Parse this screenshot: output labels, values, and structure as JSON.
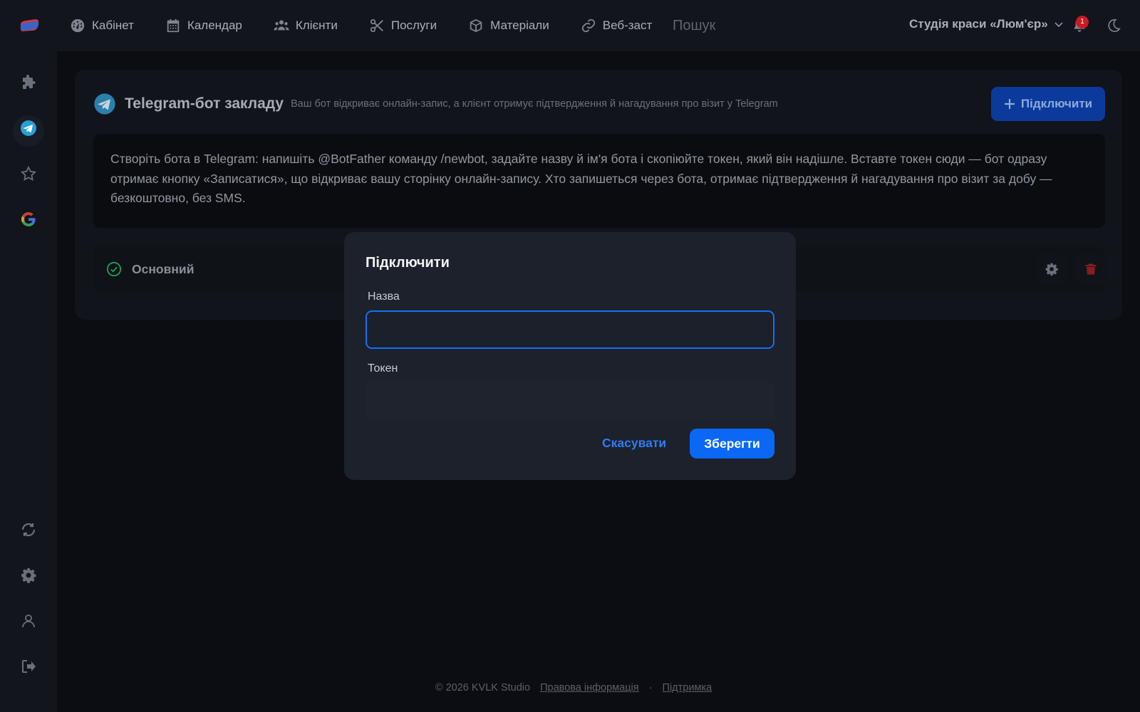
{
  "nav": {
    "items": [
      {
        "label": "Кабінет",
        "icon": "dashboard-icon"
      },
      {
        "label": "Календар",
        "icon": "calendar-icon"
      },
      {
        "label": "Клієнти",
        "icon": "users-icon"
      },
      {
        "label": "Послуги",
        "icon": "scissors-icon"
      },
      {
        "label": "Матеріали",
        "icon": "box-icon"
      },
      {
        "label": "Веб-заст",
        "icon": "link-icon"
      }
    ],
    "search_placeholder": "Пошук",
    "studio_name": "Студія краси «Люм'єр»",
    "notification_count": "1"
  },
  "sidebar": {
    "items": [
      "puzzle-icon",
      "telegram-icon",
      "star-icon",
      "google-icon",
      "sync-icon",
      "gear-icon",
      "user-icon",
      "logout-icon"
    ],
    "active": "telegram-icon"
  },
  "card": {
    "title": "Telegram-бот закладу",
    "subtitle": "Ваш бот відкриває онлайн-запис, а клієнт отримує підтвердження й нагадування про візит у Telegram",
    "connect_label": "Підключити",
    "info_text": "Створіть бота в Telegram: напишіть @BotFather команду /newbot, задайте назву й ім'я бота і скопіюйте токен, який він надішле. Вставте токен сюди — бот одразу отримає кнопку «Записатися», що відкриває вашу сторінку онлайн-запису. Хто запишеться через бота, отримає підтвердження й нагадування про візит за добу — безкоштовно, без SMS.",
    "bot": {
      "name": "Основний",
      "status": "active"
    }
  },
  "modal": {
    "title": "Підключити",
    "name_label": "Назва",
    "name_value": "",
    "token_label": "Токен",
    "token_value": "",
    "cancel_label": "Скасувати",
    "save_label": "Зберегти"
  },
  "footer": {
    "copyright": "© 2026 KVLK Studio",
    "legal": "Правова інформація",
    "separator": "·",
    "support": "Підтримка"
  },
  "colors": {
    "accent": "#0a68f5",
    "telegram": "#2a9fd6",
    "success": "#1e9e5a",
    "danger": "#c81c22",
    "badge": "#c81c22"
  }
}
